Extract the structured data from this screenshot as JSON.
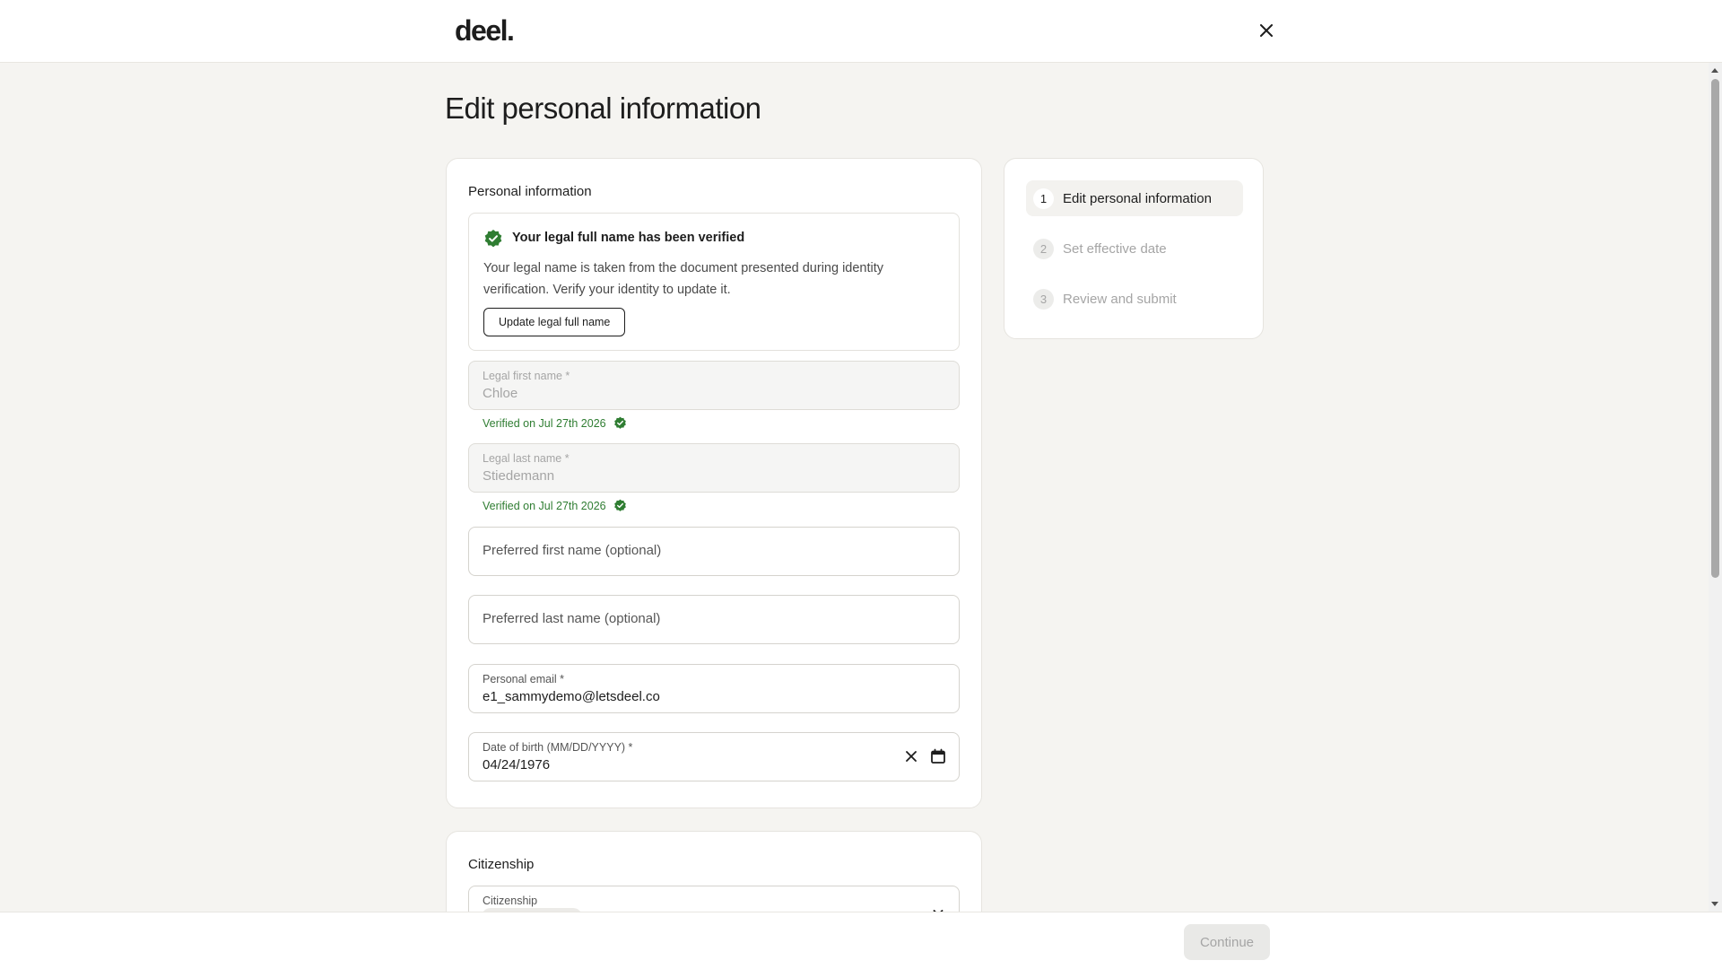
{
  "header": {
    "logo": "deel.",
    "close_icon": "close-icon"
  },
  "page": {
    "title": "Edit personal information"
  },
  "personal_info": {
    "section_title": "Personal information",
    "verified_notice": {
      "icon": "verified-check-icon",
      "title": "Your legal full name has been verified",
      "text": "Your legal name is taken from the document presented during identity verification. Verify your identity to update it.",
      "button_label": "Update legal full name"
    },
    "legal_first_name": {
      "label": "Legal first name *",
      "value": "Chloe",
      "verified_text": "Verified on Jul 27th 2026"
    },
    "legal_last_name": {
      "label": "Legal last name *",
      "value": "Stiedemann",
      "verified_text": "Verified on Jul 27th 2026"
    },
    "preferred_first_name": {
      "placeholder": "Preferred first name (optional)"
    },
    "preferred_last_name": {
      "placeholder": "Preferred last name (optional)"
    },
    "personal_email": {
      "label": "Personal email *",
      "value": "e1_sammydemo@letsdeel.co"
    },
    "date_of_birth": {
      "label": "Date of birth (MM/DD/YYYY) *",
      "value": "04/24/1976",
      "clear_icon": "clear-x-icon",
      "calendar_icon": "calendar-icon"
    }
  },
  "citizenship": {
    "section_title": "Citizenship",
    "field_label": "Citizenship",
    "chevron_icon": "chevron-down-icon"
  },
  "steps": [
    {
      "number": "1",
      "label": "Edit personal information",
      "state": "active"
    },
    {
      "number": "2",
      "label": "Set effective date",
      "state": "inactive"
    },
    {
      "number": "3",
      "label": "Review and submit",
      "state": "inactive"
    }
  ],
  "footer": {
    "continue_label": "Continue"
  },
  "colors": {
    "page_background": "#f5f4f1",
    "verified_green": "#2f7d32",
    "primary_text": "#1d1d1d",
    "muted_text": "#a5a5a5"
  }
}
